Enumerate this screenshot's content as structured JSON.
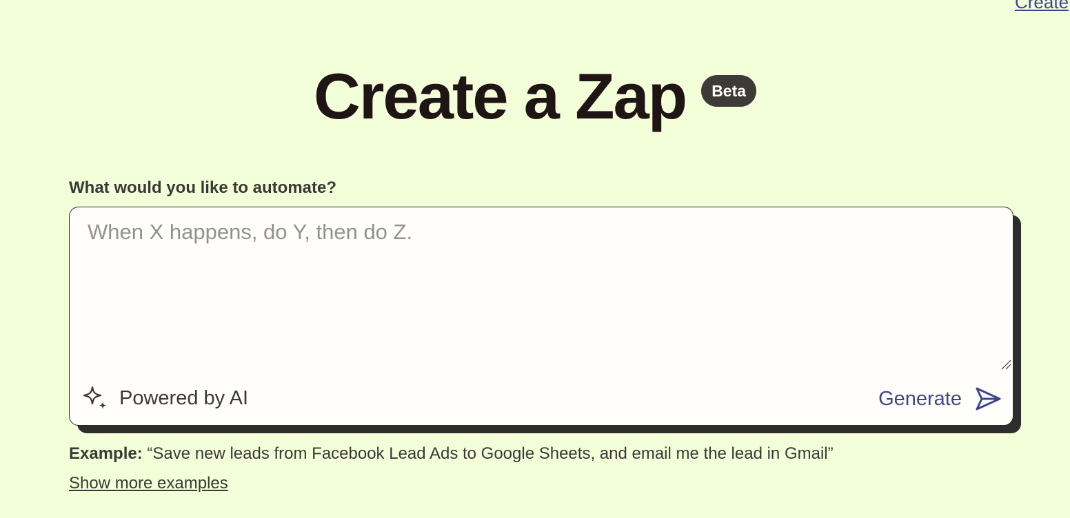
{
  "top_link": {
    "label": "Create"
  },
  "header": {
    "title": "Create a Zap",
    "badge": "Beta"
  },
  "prompt": {
    "label": "What would you like to automate?",
    "placeholder": "When X happens, do Y, then do Z.",
    "value": ""
  },
  "footer": {
    "powered_label": "Powered by AI",
    "powered_icon": "sparkle-icon",
    "generate_label": "Generate",
    "generate_icon": "send-icon"
  },
  "example": {
    "prefix": "Example:",
    "text": "“Save new leads from Facebook Lead Ads to Google Sheets, and email me the lead in Gmail”"
  },
  "show_more": {
    "label": "Show more examples"
  },
  "colors": {
    "background": "#f3ffd9",
    "title": "#201515",
    "badge": "#3d3a38",
    "accent": "#3d4592",
    "card": "#fffefa",
    "card_shadow": "#2d2d2d"
  }
}
